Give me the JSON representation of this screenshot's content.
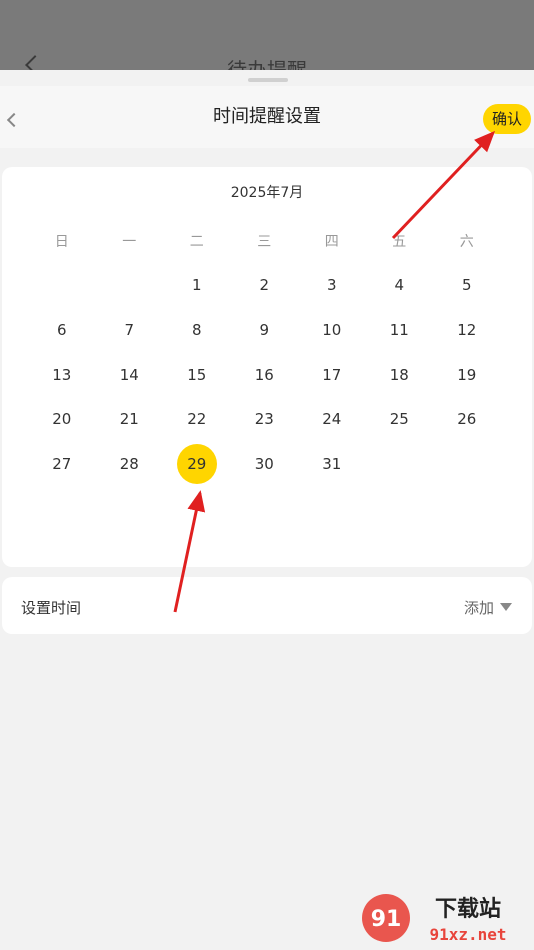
{
  "background": {
    "title": "待办提醒"
  },
  "header": {
    "title": "时间提醒设置",
    "confirm_label": "确认"
  },
  "calendar": {
    "month_label": "2025年7月",
    "weekdays": [
      "日",
      "一",
      "二",
      "三",
      "四",
      "五",
      "六"
    ],
    "leading_blanks": 2,
    "days": [
      "1",
      "2",
      "3",
      "4",
      "5",
      "6",
      "7",
      "8",
      "9",
      "10",
      "11",
      "12",
      "13",
      "14",
      "15",
      "16",
      "17",
      "18",
      "19",
      "20",
      "21",
      "22",
      "23",
      "24",
      "25",
      "26",
      "27",
      "28",
      "29",
      "30",
      "31"
    ],
    "selected_day": "29"
  },
  "time_setting": {
    "label": "设置时间",
    "value": "添加"
  },
  "watermark": {
    "brand": "下载站",
    "domain": "91xz.net"
  },
  "colors": {
    "accent": "#ffd500",
    "arrow": "#e02020"
  }
}
